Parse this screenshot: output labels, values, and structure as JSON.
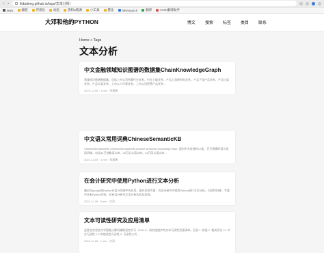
{
  "browser": {
    "url": "hidadeng.github.io/tags/文本分析/",
    "bookmarks": [
      "latex",
      "编程",
      "可视化",
      "动态",
      "资料&教源",
      "小工具",
      "量化",
      "hiResearch",
      "翻译",
      "CNKI翻译助手"
    ]
  },
  "site": {
    "title": "大邓和他的PYTHON",
    "nav": [
      "博文",
      "搜索",
      "标签",
      "类目",
      "联系"
    ]
  },
  "page": {
    "breadcrumb": "Home » Tags",
    "title": "文本分析"
  },
  "posts": [
    {
      "title": "中文金融领域知识图谱的数据集ChainKnowledgeGraph",
      "excerpt": "领域知识图谱数据集，包括上市公司所属行业关系、行业上级关系、产品上游原材料关系、产品下游产品关系、产品小类关系、产品大类关系、上市公人代表关系、上市公司经营产品关系...",
      "meta": "2021-12-06 · 1 min · 刘焕勇"
    },
    {
      "title": "中文语义常用词典ChineseSemanticKB",
      "excerpt": "ChineseSemanticKB ChineseSemanticKB,chinese semantic knowledge base, 面向中文处理的12类、百万规模的语义常用词典，包括34万抽象语义库、34万反义语义库、43万同义语义库...",
      "meta": "2021-12-06 · 1 min · 刘焕勇"
    },
    {
      "title": "在会计研究中使用Python进行文本分析",
      "excerpt": "最近在google搜Python在会计领域中的应用，意外发现专著：在会计研究中使用Python进行文本分析。内容特别棒，专著中含有Python代码，也有会计研究文本分析的实际案例。",
      "meta": "2021-11-26 · 3 min · 大邓"
    },
    {
      "title": "文本可读性研究及应用清单",
      "excerpt": "这是北京语言大学智能计算机辅助语言学习（ICALL）研究组维护的文本可读性资源清单。目录 1. 综述 2. 相关研讨 2.1 中文可读性 2.2 其他语言可读性 3. 可读性公式 ...",
      "meta": "2021-11-26 · 1 min · 大邓"
    }
  ]
}
